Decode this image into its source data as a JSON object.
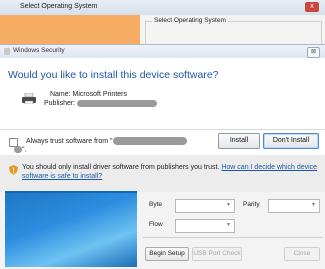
{
  "background_window": {
    "title": "Select Operating System",
    "close_label": "x",
    "group_label": "Select Operating System"
  },
  "dialog": {
    "title": "Windows Security",
    "close_label": "⊠",
    "heading": "Would you like to install this device software?",
    "name_label": "Name:",
    "name_value": "Microsoft Printers",
    "publisher_label": "Publisher:",
    "always_trust_label": "Always trust software from \"",
    "always_trust_suffix": "\".",
    "install_label": "Install",
    "dont_install_label": "Don't Install",
    "warning_text": "You should only install driver software from publishers you trust.",
    "warning_link": "How can I decide which device software is safe to install?"
  },
  "settings": {
    "byte_label": "Byte",
    "parity_label": "Parity",
    "flow_label": "Flow",
    "begin_setup_label": "Begin Setup",
    "usb_port_check_label": "USB Port Check",
    "close_label": "Close"
  },
  "colors": {
    "heading": "#1d57a3",
    "orange_panel": "#f6ad63",
    "blue_image": "#2c8de0"
  }
}
